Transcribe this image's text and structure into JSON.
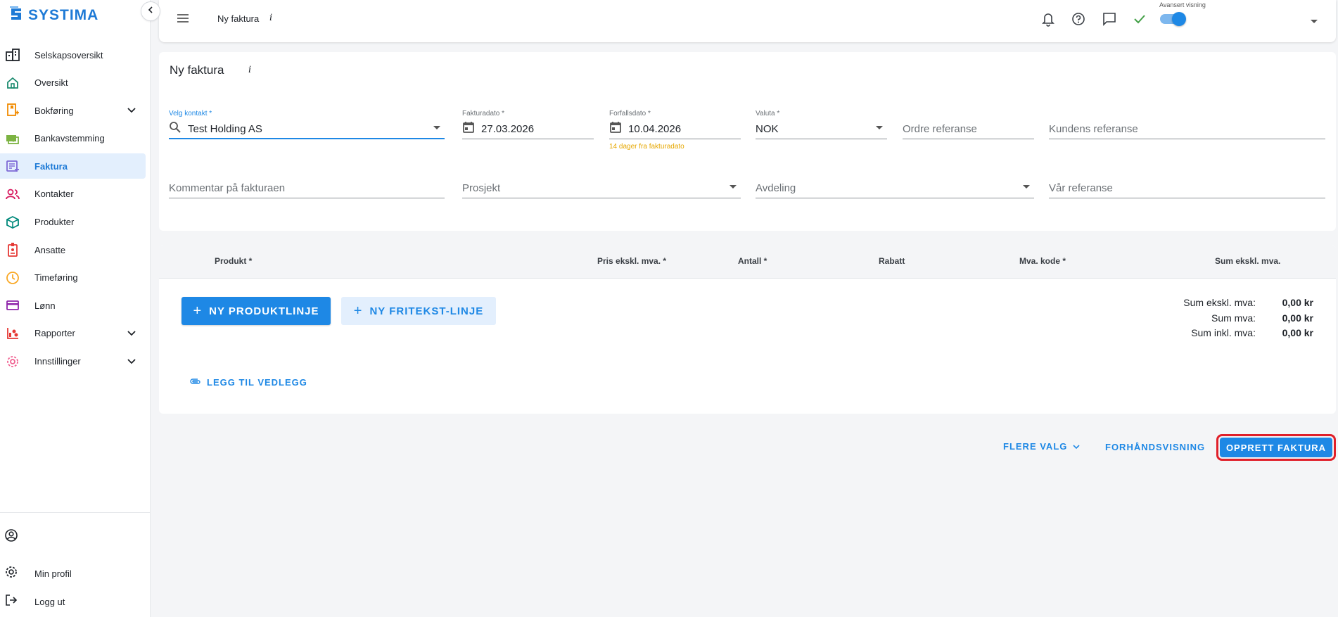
{
  "app": {
    "brand": "SYSTIMA"
  },
  "sidebar": {
    "items": [
      {
        "label": "Selskapsoversikt",
        "icon": "buildings-icon",
        "color": "#1f2329"
      },
      {
        "label": "Oversikt",
        "icon": "home-icon",
        "color": "#1a8a6e"
      },
      {
        "label": "Bokføring",
        "icon": "ledger-icon",
        "color": "#f08a00",
        "expandable": true
      },
      {
        "label": "Bankavstemming",
        "icon": "bank-icon",
        "color": "#7cb342"
      },
      {
        "label": "Faktura",
        "icon": "invoice-icon",
        "color": "#7e6ad6",
        "active": true
      },
      {
        "label": "Kontakter",
        "icon": "people-icon",
        "color": "#d81b60"
      },
      {
        "label": "Produkter",
        "icon": "box-icon",
        "color": "#00897b"
      },
      {
        "label": "Ansatte",
        "icon": "badge-icon",
        "color": "#e53935"
      },
      {
        "label": "Timeføring",
        "icon": "clock-icon",
        "color": "#f9a825"
      },
      {
        "label": "Lønn",
        "icon": "card-icon",
        "color": "#8e24aa"
      },
      {
        "label": "Rapporter",
        "icon": "chart-icon",
        "color": "#e53935",
        "expandable": true
      },
      {
        "label": "Innstillinger",
        "icon": "gear-icon",
        "color": "#f06292",
        "expandable": true
      }
    ],
    "bottom": [
      {
        "label": "",
        "icon": "account-circle-icon"
      },
      {
        "label": "Min profil",
        "icon": "settings-icon"
      },
      {
        "label": "Logg ut",
        "icon": "logout-icon"
      }
    ]
  },
  "topbar": {
    "title": "Ny faktura",
    "info": "i",
    "toggle_label": "Avansert visning",
    "toggle_on": true
  },
  "form": {
    "title": "Ny faktura",
    "info": "i",
    "contact": {
      "label": "Velg kontakt *",
      "value": "Test Holding AS"
    },
    "invoice_date": {
      "label": "Fakturadato *",
      "value": "27.03.2026"
    },
    "due_date": {
      "label": "Forfallsdato *",
      "value": "10.04.2026",
      "hint": "14 dager fra fakturadato"
    },
    "currency": {
      "label": "Valuta *",
      "value": "NOK"
    },
    "order_ref": {
      "placeholder": "Ordre referanse"
    },
    "customer_ref": {
      "placeholder": "Kundens referanse"
    },
    "comment": {
      "placeholder": "Kommentar på fakturaen"
    },
    "project": {
      "placeholder": "Prosjekt"
    },
    "department": {
      "placeholder": "Avdeling"
    },
    "our_ref": {
      "placeholder": "Vår referanse"
    }
  },
  "products": {
    "columns": [
      "Produkt *",
      "Pris ekskl. mva. *",
      "Antall *",
      "Rabatt",
      "Mva. kode *",
      "Sum ekskl. mva."
    ],
    "new_line_label": "NY PRODUKTLINJE",
    "new_text_line_label": "NY FRITEKST-LINJE",
    "attach_label": "LEGG TIL VEDLEGG",
    "sums": [
      {
        "label": "Sum ekskl. mva:",
        "value": "0,00 kr"
      },
      {
        "label": "Sum mva:",
        "value": "0,00 kr"
      },
      {
        "label": "Sum inkl. mva:",
        "value": "0,00 kr"
      }
    ]
  },
  "actions": {
    "more_label": "FLERE VALG",
    "preview_label": "FORHÅNDSVISNING",
    "create_label": "OPPRETT FAKTURA"
  },
  "colors": {
    "accent": "#1e88e5",
    "highlight_border": "#e0202a",
    "hint": "#e6a700"
  }
}
